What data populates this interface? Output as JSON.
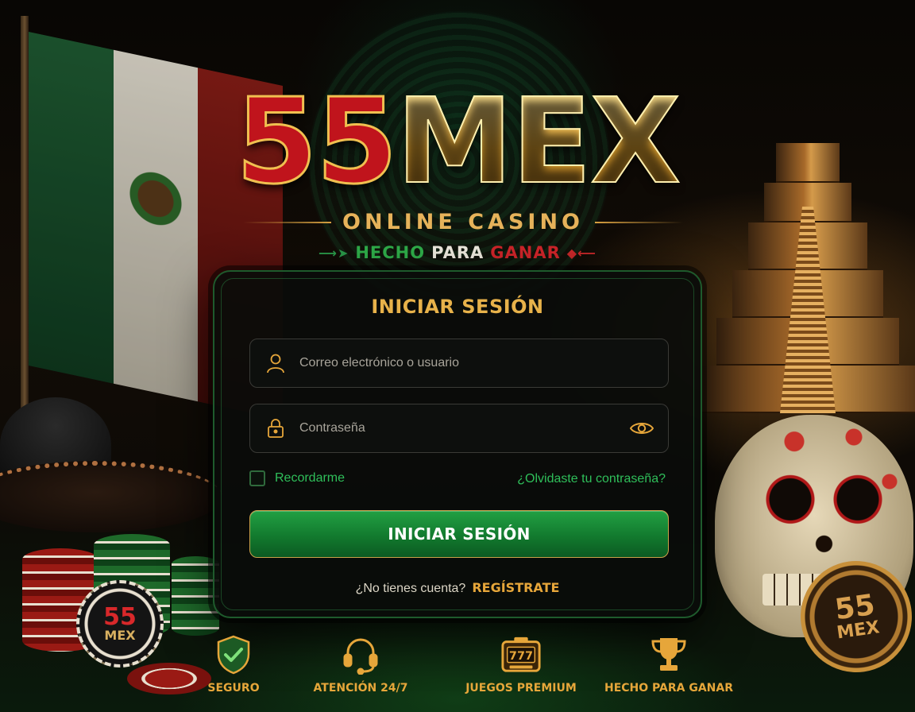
{
  "brand": {
    "number": "55",
    "name": "MEX",
    "tagline": "ONLINE CASINO",
    "slogan": [
      "HECHO",
      "PARA",
      "GANAR"
    ]
  },
  "login": {
    "title": "INICIAR SESIÓN",
    "username_placeholder": "Correo electrónico o usuario",
    "username_value": "",
    "password_placeholder": "Contraseña",
    "password_value": "",
    "remember_label": "Recordarme",
    "remember_checked": false,
    "forgot_link": "¿Olvidaste tu contraseña?",
    "submit_label": "INICIAR SESIÓN",
    "no_account_text": "¿No tienes cuenta?",
    "register_link": "REGÍSTRATE"
  },
  "chip": {
    "number": "55",
    "name": "MEX"
  },
  "coin": {
    "number": "55",
    "name": "MEX"
  },
  "features": [
    {
      "icon": "shield-check-icon",
      "label": "SEGURO"
    },
    {
      "icon": "headset-icon",
      "label": "ATENCIÓN 24/7"
    },
    {
      "icon": "slot-machine-icon",
      "label": "JUEGOS PREMIUM"
    },
    {
      "icon": "trophy-icon",
      "label": "HECHO PARA GANAR"
    }
  ],
  "colors": {
    "gold": "#e6a63a",
    "green": "#2fbf5a",
    "red": "#c0141c",
    "card_bg": "#0a0c0a"
  }
}
